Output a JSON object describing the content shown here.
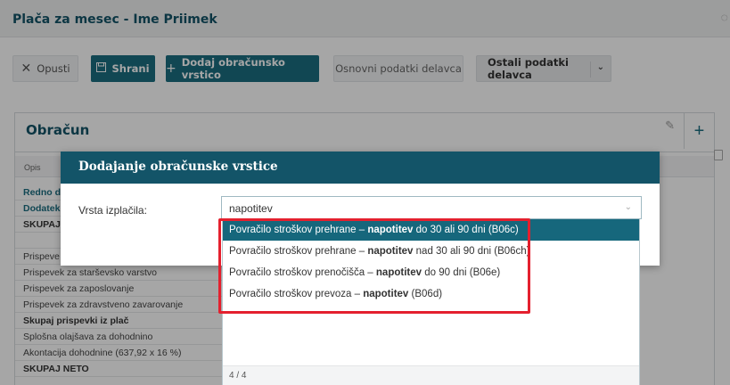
{
  "header": {
    "title": "Plača za mesec - Ime Priimek"
  },
  "toolbar": {
    "cancel_label": "Opusti",
    "save_label": "Shrani",
    "add_line_label": "Dodaj obračunsko vrstico",
    "basic_data_label": "Osnovni podatki delavca",
    "other_data_label": "Ostali podatki delavca"
  },
  "panel": {
    "title": "Obračun",
    "column_header": "Opis",
    "rows": [
      "Redno d",
      "Dodatek",
      "SKUPAJ",
      "",
      "Prispeve",
      "Prispevek za starševsko varstvo",
      "Prispevek za zaposlovanje",
      "Prispevek za zdravstveno zavarovanje",
      "Skupaj prispevki iz plač",
      "Splošna olajšava za dohodnino",
      "Akontacija dohodnine (637,92 x 16 %)",
      "SKUPAJ NETO"
    ]
  },
  "modal": {
    "title": "Dodajanje obračunske vrstice",
    "field_label": "Vrsta izplačila:",
    "field_value": "napotitev"
  },
  "dropdown": {
    "options": [
      {
        "pre": "Povračilo stroškov prehrane – ",
        "bold": "napotitev",
        "post": " do 30 ali 90 dni (B06c)"
      },
      {
        "pre": "Povračilo stroškov prehrane – ",
        "bold": "napotitev",
        "post": " nad 30 ali 90 dni (B06ch)"
      },
      {
        "pre": "Povračilo stroškov prenočišča – ",
        "bold": "napotitev",
        "post": " do 90 dni (B06e)"
      },
      {
        "pre": "Povračilo stroškov prevoza – ",
        "bold": "napotitev",
        "post": " (B06d)"
      }
    ],
    "count": "4 / 4"
  },
  "colors": {
    "brand": "#135468",
    "accent": "#1b6d80",
    "highlight": "#e4202e"
  },
  "icons": [
    "close-icon",
    "save-icon",
    "plus-icon",
    "chevron-down-icon",
    "pencil-icon",
    "plus-icon"
  ]
}
